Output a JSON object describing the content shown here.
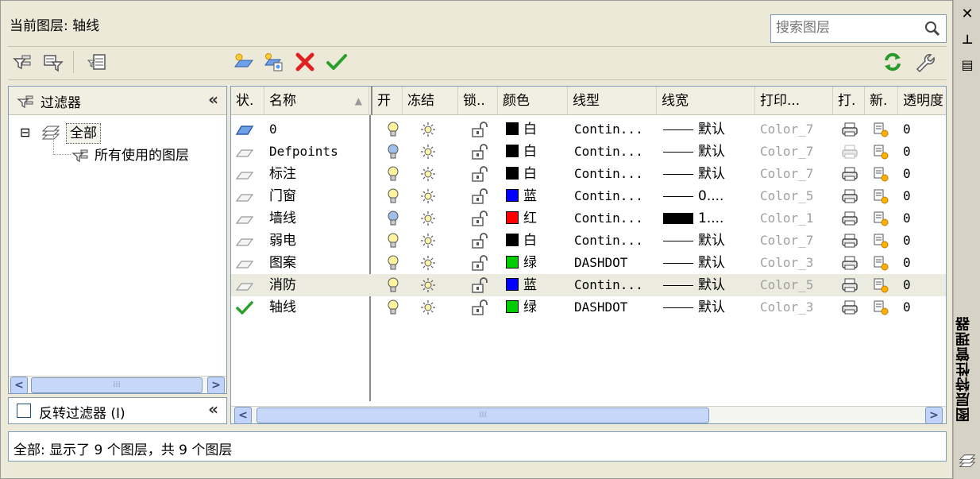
{
  "window": {
    "vertical_title": "图层特性管理器",
    "close_glyph": "✕",
    "pin_glyph": "⊥",
    "props_glyph": "▤"
  },
  "header": {
    "current_layer": "当前图层: 轴线",
    "search_placeholder": "搜索图层"
  },
  "filter_panel": {
    "title": "过滤器",
    "collapse_glyph": "«",
    "tree": [
      {
        "label": "全部",
        "expander": "⊟",
        "selected": true
      },
      {
        "label": "所有使用的图层"
      }
    ],
    "invert_label": "反转过滤器 (I)",
    "invert_checked": false
  },
  "grid": {
    "columns": [
      "状.",
      "名称",
      "开",
      "冻结",
      "锁..",
      "颜色",
      "线型",
      "线宽",
      "打印...",
      "打.",
      "新.",
      "透明度"
    ],
    "sort_glyph": "▲",
    "rows": [
      {
        "status": "current-layer-stack",
        "name": "0",
        "on": true,
        "freeze": "sun",
        "lock": "unlocked",
        "color_hex": "#000000",
        "color_name": "白",
        "linetype": "Contin...",
        "lineweight_line": "thin",
        "lineweight": "默认",
        "plot_style": "Color_7",
        "plot": "printer",
        "newvp": "freeze-vp",
        "transparency": "0",
        "highlight": false
      },
      {
        "status": "layer",
        "name": "Defpoints",
        "on": true,
        "freeze": "sun",
        "lock": "unlocked",
        "color_hex": "#000000",
        "color_name": "白",
        "linetype": "Contin...",
        "lineweight_line": "thin",
        "lineweight": "默认",
        "plot_style": "Color_7",
        "plot": "printer-disabled",
        "newvp": "freeze-vp",
        "transparency": "0",
        "highlight": false
      },
      {
        "status": "layer",
        "name": "标注",
        "on": true,
        "freeze": "sun",
        "lock": "unlocked",
        "color_hex": "#000000",
        "color_name": "白",
        "linetype": "Contin...",
        "lineweight_line": "thin",
        "lineweight": "默认",
        "plot_style": "Color_7",
        "plot": "printer",
        "newvp": "freeze-vp",
        "transparency": "0",
        "highlight": false
      },
      {
        "status": "layer",
        "name": "门窗",
        "on": true,
        "freeze": "sun",
        "lock": "unlocked",
        "color_hex": "#0000ff",
        "color_name": "蓝",
        "linetype": "Contin...",
        "lineweight_line": "thin",
        "lineweight": "0....",
        "plot_style": "Color_5",
        "plot": "printer",
        "newvp": "freeze-vp",
        "transparency": "0",
        "highlight": false
      },
      {
        "status": "layer",
        "name": "墙线",
        "on": true,
        "freeze": "sun",
        "lock": "unlocked",
        "color_hex": "#ff0000",
        "color_name": "红",
        "linetype": "Contin...",
        "lineweight_line": "thick",
        "lineweight": "1....",
        "plot_style": "Color_1",
        "plot": "printer",
        "newvp": "freeze-vp",
        "transparency": "0",
        "highlight": false
      },
      {
        "status": "layer",
        "name": "弱电",
        "on": true,
        "freeze": "sun",
        "lock": "unlocked",
        "color_hex": "#000000",
        "color_name": "白",
        "linetype": "Contin...",
        "lineweight_line": "thin",
        "lineweight": "默认",
        "plot_style": "Color_7",
        "plot": "printer",
        "newvp": "freeze-vp",
        "transparency": "0",
        "highlight": false
      },
      {
        "status": "layer",
        "name": "图案",
        "on": true,
        "freeze": "sun",
        "lock": "unlocked",
        "color_hex": "#00cc00",
        "color_name": "绿",
        "linetype": "DASHDOT",
        "lineweight_line": "thin",
        "lineweight": "默认",
        "plot_style": "Color_3",
        "plot": "printer",
        "newvp": "freeze-vp",
        "transparency": "0",
        "highlight": false
      },
      {
        "status": "layer",
        "name": "消防",
        "on": true,
        "freeze": "sun",
        "lock": "unlocked",
        "color_hex": "#0000ff",
        "color_name": "蓝",
        "linetype": "Contin...",
        "lineweight_line": "thin",
        "lineweight": "默认",
        "plot_style": "Color_5",
        "plot": "printer",
        "newvp": "freeze-vp",
        "transparency": "0",
        "highlight": true
      },
      {
        "status": "current",
        "name": "轴线",
        "on": true,
        "freeze": "sun",
        "lock": "unlocked",
        "color_hex": "#00cc00",
        "color_name": "绿",
        "linetype": "DASHDOT",
        "lineweight_line": "thin",
        "lineweight": "默认",
        "plot_style": "Color_3",
        "plot": "printer",
        "newvp": "freeze-vp",
        "transparency": "0",
        "highlight": false
      }
    ]
  },
  "scrollbar": {
    "grip": "⁞⁞⁞"
  },
  "status_bar": {
    "text": "全部: 显示了 9 个图层，共 9 个图层"
  },
  "colors": {
    "accent": "#316ac5",
    "panel_border": "#7f9db9",
    "window_bg": "#ece9d8",
    "highlight_row": "#ecebe0"
  }
}
